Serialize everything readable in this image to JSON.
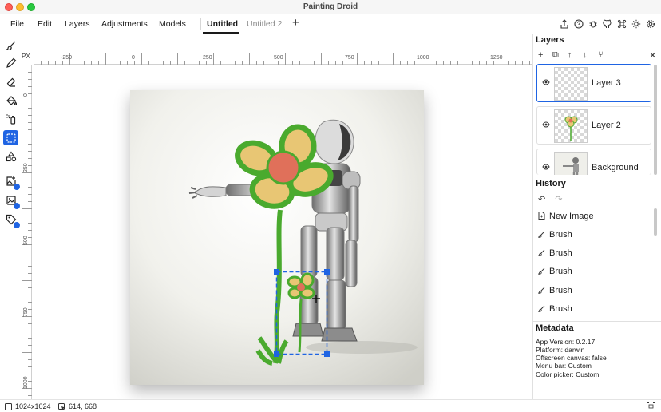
{
  "window": {
    "title": "Painting Droid"
  },
  "menu": {
    "items": [
      "File",
      "Edit",
      "Layers",
      "Adjustments",
      "Models"
    ],
    "tabs": [
      {
        "label": "Untitled",
        "active": true
      },
      {
        "label": "Untitled 2",
        "active": false
      }
    ],
    "add_tab": "+",
    "right_icons": [
      "export-icon",
      "help-icon",
      "bug-icon",
      "github-icon",
      "command-icon",
      "theme-icon",
      "settings-icon"
    ]
  },
  "toolbar": {
    "tools": [
      {
        "name": "brush-tool",
        "icon": "brush-icon",
        "active": false
      },
      {
        "name": "pencil-tool",
        "icon": "pencil-icon",
        "active": false
      },
      {
        "name": "eraser-tool",
        "icon": "eraser-icon",
        "active": false
      },
      {
        "name": "fill-tool",
        "icon": "paint-bucket-icon",
        "active": false
      },
      {
        "name": "spray-tool",
        "icon": "spray-can-icon",
        "active": false
      },
      {
        "name": "selection-tool",
        "icon": "selection-icon",
        "active": true
      },
      {
        "name": "shapes-tool",
        "icon": "shapes-icon",
        "active": false
      },
      {
        "name": "ai-image-tool",
        "icon": "image-plus-icon",
        "active": false
      },
      {
        "name": "ai-inpaint-tool",
        "icon": "image-edit-icon",
        "active": false
      },
      {
        "name": "ai-tag-tool",
        "icon": "tag-icon",
        "active": false
      }
    ]
  },
  "ruler": {
    "unit": "PX",
    "h_labels": [
      "-250",
      "0",
      "250",
      "500",
      "750",
      "1000",
      "1250"
    ],
    "v_labels": [
      "0",
      "250",
      "500",
      "750",
      "1000"
    ]
  },
  "layers": {
    "title": "Layers",
    "tools": [
      "+",
      "⧉",
      "↑",
      "↓",
      "⑂"
    ],
    "close": "✕",
    "items": [
      {
        "name": "Layer 3",
        "selected": true
      },
      {
        "name": "Layer 2",
        "selected": false
      },
      {
        "name": "Background",
        "selected": false
      }
    ]
  },
  "history": {
    "title": "History",
    "undo": "↶",
    "redo": "↷",
    "items": [
      {
        "label": "New Image",
        "icon": "file-icon"
      },
      {
        "label": "Brush",
        "icon": "brush-icon"
      },
      {
        "label": "Brush",
        "icon": "brush-icon"
      },
      {
        "label": "Brush",
        "icon": "brush-icon"
      },
      {
        "label": "Brush",
        "icon": "brush-icon"
      },
      {
        "label": "Brush",
        "icon": "brush-icon"
      }
    ]
  },
  "metadata": {
    "title": "Metadata",
    "lines": [
      "App Version: 0.2.17",
      "Platform: darwin",
      "Offscreen canvas: false",
      "Menu bar: Custom",
      "Color picker: Custom"
    ]
  },
  "status": {
    "canvas_size": "1024x1024",
    "cursor_position": "614, 668"
  },
  "colors": {
    "accent": "#1f64e3",
    "flower_stroke": "#4aaa2e",
    "petal": "#e8c674",
    "center": "#e0705a"
  }
}
